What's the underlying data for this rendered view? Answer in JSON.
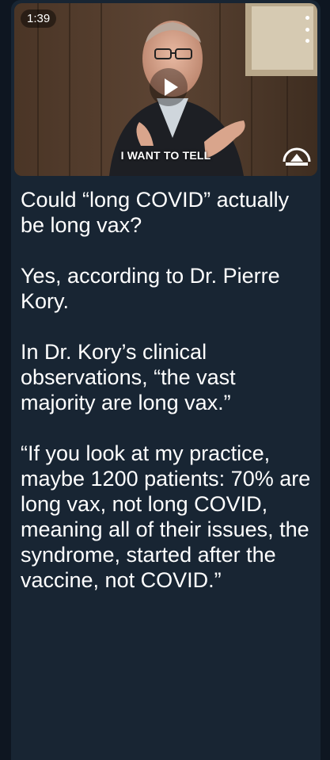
{
  "video": {
    "duration": "1:39",
    "caption": "I WANT TO TELL"
  },
  "message": {
    "paragraphs": [
      "Could “long COVID” actually be long vax?",
      "Yes, according to Dr. Pierre Kory.",
      "In Dr. Kory’s clinical observations, “the vast majority are long vax.”",
      "“If you look at my practice, maybe 1200 patients: 70% are long vax, not long COVID, meaning all of their issues, the syndrome, started after the vaccine, not COVID.”"
    ]
  },
  "icons": {
    "play": "play-icon",
    "menu": "more-vertical-icon",
    "logo": "channel-logo-icon"
  },
  "colors": {
    "background": "#0e1621",
    "bubble": "#182533",
    "text": "#ffffff"
  }
}
